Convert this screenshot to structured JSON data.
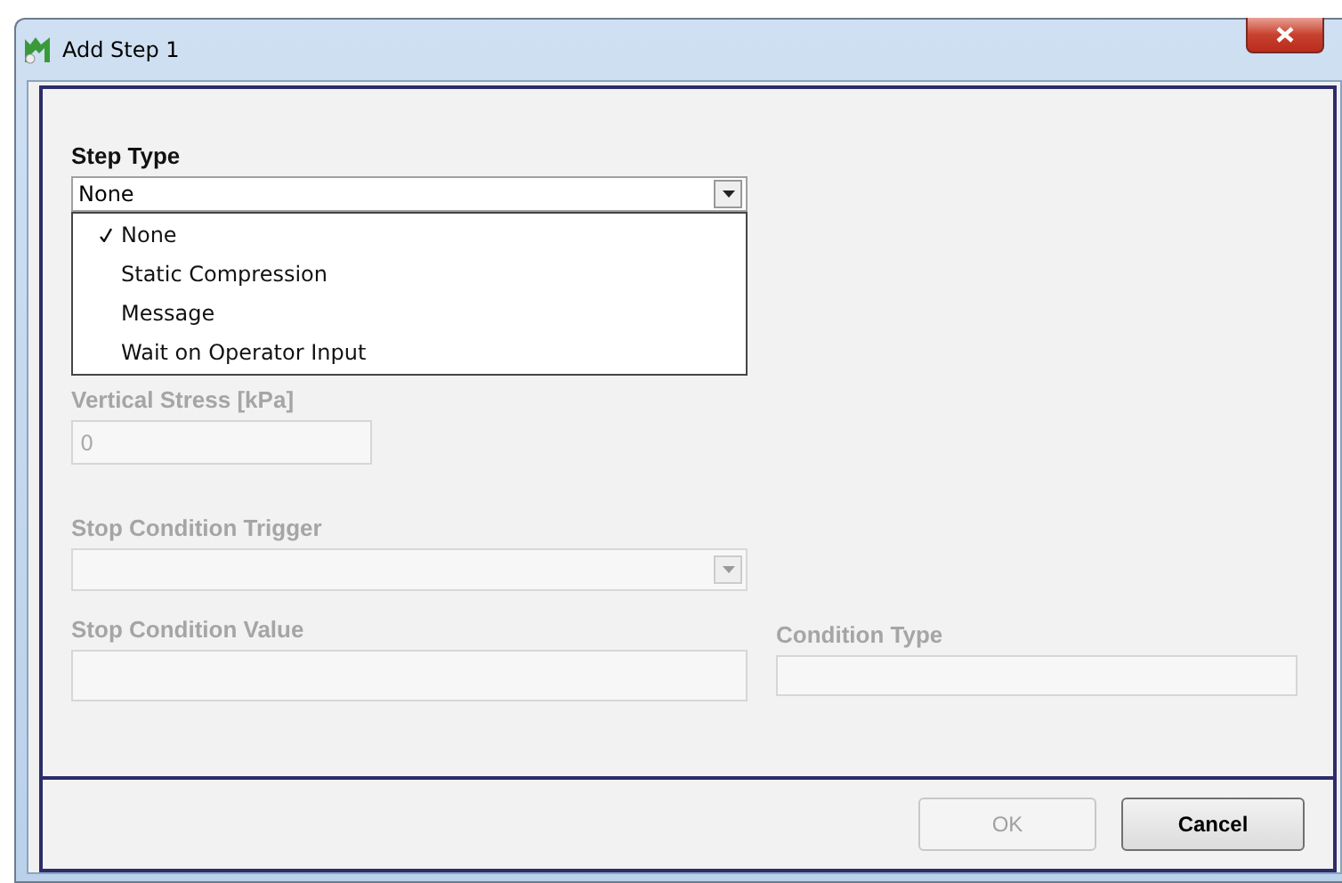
{
  "window": {
    "title": "Add Step 1"
  },
  "step_type": {
    "label": "Step Type",
    "value": "None",
    "expanded": true,
    "options": [
      {
        "label": "None",
        "selected": true
      },
      {
        "label": "Static Compression",
        "selected": false
      },
      {
        "label": "Message",
        "selected": false
      },
      {
        "label": "Wait on Operator Input",
        "selected": false
      }
    ]
  },
  "vertical_stress": {
    "label": "Vertical Stress [kPa]",
    "value": "0",
    "disabled": true
  },
  "stop_condition_trigger": {
    "label": "Stop Condition Trigger",
    "disabled": true
  },
  "stop_condition_value": {
    "label": "Stop Condition Value",
    "disabled": true
  },
  "condition_type": {
    "label": "Condition Type",
    "disabled": true
  },
  "buttons": [
    {
      "label": "OK",
      "disabled": true
    },
    {
      "label": "Cancel",
      "disabled": false
    }
  ]
}
